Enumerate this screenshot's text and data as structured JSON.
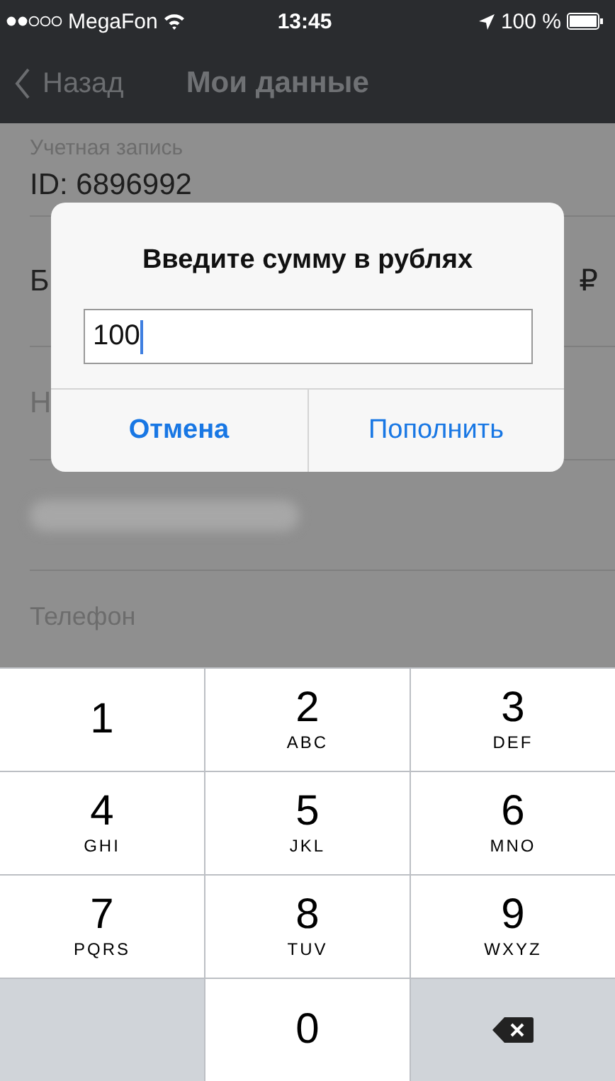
{
  "status_bar": {
    "carrier": "MegaFon",
    "time": "13:45",
    "battery": "100 %"
  },
  "nav_bar": {
    "back": "Назад",
    "title": "Мои данные"
  },
  "rows": [
    {
      "kind": "account",
      "label": "Учетная запись",
      "value": "ID: 6896992"
    },
    {
      "kind": "partial",
      "left": "Б",
      "right": "₽"
    },
    {
      "kind": "partial",
      "left": "Н"
    },
    {
      "kind": "blurred"
    },
    {
      "kind": "label",
      "label": "Телефон"
    }
  ],
  "dialog": {
    "title": "Введите сумму в рублях",
    "value": "100",
    "buttons": [
      {
        "label": "Отмена",
        "bold": true
      },
      {
        "label": "Пополнить",
        "bold": false
      }
    ]
  },
  "keypad": [
    {
      "kind": "digit",
      "digit": "1"
    },
    {
      "kind": "digit",
      "digit": "2",
      "letters": "ABC"
    },
    {
      "kind": "digit",
      "digit": "3",
      "letters": "DEF"
    },
    {
      "kind": "digit",
      "digit": "4",
      "letters": "GHI"
    },
    {
      "kind": "digit",
      "digit": "5",
      "letters": "JKL"
    },
    {
      "kind": "digit",
      "digit": "6",
      "letters": "MNO"
    },
    {
      "kind": "digit",
      "digit": "7",
      "letters": "PQRS"
    },
    {
      "kind": "digit",
      "digit": "8",
      "letters": "TUV"
    },
    {
      "kind": "digit",
      "digit": "9",
      "letters": "WXYZ"
    },
    {
      "kind": "blank"
    },
    {
      "kind": "digit",
      "digit": "0"
    },
    {
      "kind": "backspace"
    }
  ]
}
